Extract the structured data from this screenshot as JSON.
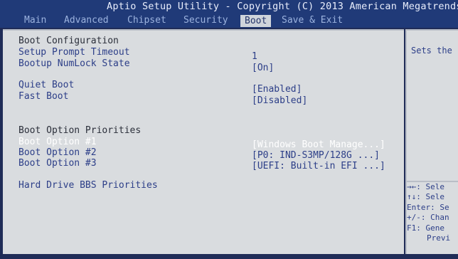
{
  "title": "Aptio Setup Utility - Copyright (C) 2013 American Megatrends",
  "menu": {
    "tabs": [
      "Main",
      "Advanced",
      "Chipset",
      "Security",
      "Boot",
      "Save & Exit"
    ],
    "active": "Boot"
  },
  "colors": {
    "header_bg": "#203a78",
    "panel_bg": "#d9dcdf",
    "label_text": "#2c3e88",
    "selected_text": "#ffffff"
  },
  "boot": {
    "section_boot_config": "Boot Configuration",
    "setup_prompt_timeout": {
      "label": "Setup Prompt Timeout",
      "value": "1"
    },
    "bootup_numlock_state": {
      "label": "Bootup NumLock State",
      "value": "[On]"
    },
    "quiet_boot": {
      "label": "Quiet Boot",
      "value": "[Enabled]"
    },
    "fast_boot": {
      "label": "Fast Boot",
      "value": "[Disabled]"
    },
    "section_boot_priorities": "Boot Option Priorities",
    "boot_option_1": {
      "label": "Boot Option #1",
      "value": "[Windows Boot Manage...]"
    },
    "boot_option_2": {
      "label": "Boot Option #2",
      "value": "[P0: IND-S3MP/128G   ...]"
    },
    "boot_option_3": {
      "label": "Boot Option #3",
      "value": "[UEFI: Built-in EFI ...]"
    },
    "hard_drive_bbs": {
      "label": "Hard Drive BBS Priorities"
    }
  },
  "help": {
    "description": "Sets the",
    "keys": [
      "→←: Sele",
      "↑↓: Sele",
      "Enter: Se",
      "+/-: Chan",
      "F1: Gene",
      "Previ"
    ]
  }
}
